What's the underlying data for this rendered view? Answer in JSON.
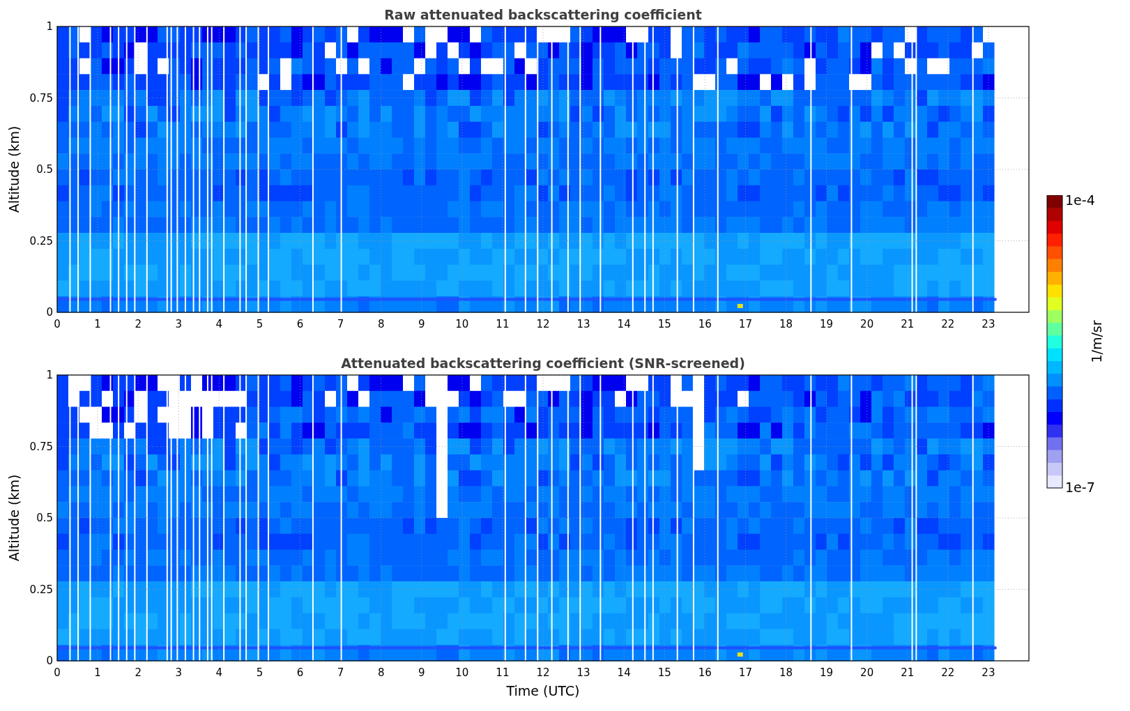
{
  "panels": [
    {
      "kind": "raw",
      "title": "Raw attenuated backscattering coefficient",
      "ylabel": "Altitude (km)",
      "yticks": [
        "1",
        "0.75",
        "0.5",
        "0.25",
        "0"
      ],
      "xticks": [
        "0",
        "1",
        "2",
        "3",
        "4",
        "5",
        "6",
        "7",
        "8",
        "9",
        "10",
        "11",
        "12",
        "13",
        "14",
        "15",
        "16",
        "17",
        "18",
        "19",
        "20",
        "21",
        "22",
        "23"
      ]
    },
    {
      "kind": "screened",
      "title": "Attenuated backscattering coefficient (SNR-screened)",
      "ylabel": "Altitude (km)",
      "yticks": [
        "1",
        "0.75",
        "0.5",
        "0.25",
        "0"
      ],
      "xticks": [
        "0",
        "1",
        "2",
        "3",
        "4",
        "5",
        "6",
        "7",
        "8",
        "9",
        "10",
        "11",
        "12",
        "13",
        "14",
        "15",
        "16",
        "17",
        "18",
        "19",
        "20",
        "21",
        "22",
        "23"
      ]
    }
  ],
  "xlabel": "Time (UTC)",
  "colorbar": {
    "max_label": "1e-4",
    "min_label": "1e-7",
    "label": "1/m/sr"
  }
}
